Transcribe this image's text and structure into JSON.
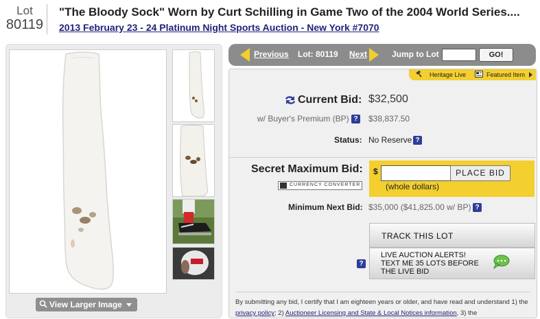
{
  "header": {
    "lot_label": "Lot",
    "lot_number": "80119",
    "title": "\"The Bloody Sock\" Worn by Curt Schilling in Game Two of the 2004 World Series....",
    "auction_link": "2013 February 23 - 24 Platinum Night Sports Auction - New York #7070"
  },
  "gallery": {
    "view_larger": "View Larger Image",
    "thumbnails": [
      "sock-thumb-full",
      "sock-thumb-detail",
      "cleat-photo",
      "red-sox-photo"
    ]
  },
  "lot_nav": {
    "previous": "Previous",
    "lot": "Lot: 80119",
    "next": "Next",
    "jump_label": "Jump to Lot",
    "jump_value": "",
    "go": "GO!"
  },
  "tabs": {
    "heritage_live": "Heritage Live",
    "featured_item": "Featured Item"
  },
  "bid": {
    "current_bid_label": "Current Bid:",
    "current_bid_value": "$32,500",
    "bp_label": "w/ Buyer's Premium (BP)",
    "bp_value": "$38,837.50",
    "status_label": "Status:",
    "status_value": "No Reserve",
    "secret_max_label": "Secret Maximum Bid:",
    "currency_converter": "CURRENCY CONVERTER",
    "dollar_sign": "$",
    "bid_input_value": "",
    "place_bid": "PLACE BID",
    "whole_dollars": "(whole dollars)",
    "min_next_label": "Minimum Next Bid:",
    "min_next_value": "$35,000 ($41,825.00 w/ BP)",
    "help": "?"
  },
  "actions": {
    "track": "TRACK THIS LOT",
    "alerts_line1": "LIVE AUCTION ALERTS!",
    "alerts_line2": "TEXT ME 35 LOTS BEFORE",
    "alerts_line3": "THE LIVE BID"
  },
  "legal": {
    "text1": "By submitting any bid, I certify that I am eighteen years or older, and have read and understand 1) the ",
    "privacy": "privacy policy",
    "text2": "; 2) ",
    "licensing": "Auctioneer Licensing and State & Local Notices information",
    "text3": ", 3) the"
  },
  "colors": {
    "accent_yellow": "#f3cf2f",
    "nav_gray": "#8c8c8c",
    "help_blue": "#2e3d9a",
    "link": "#22227a"
  }
}
